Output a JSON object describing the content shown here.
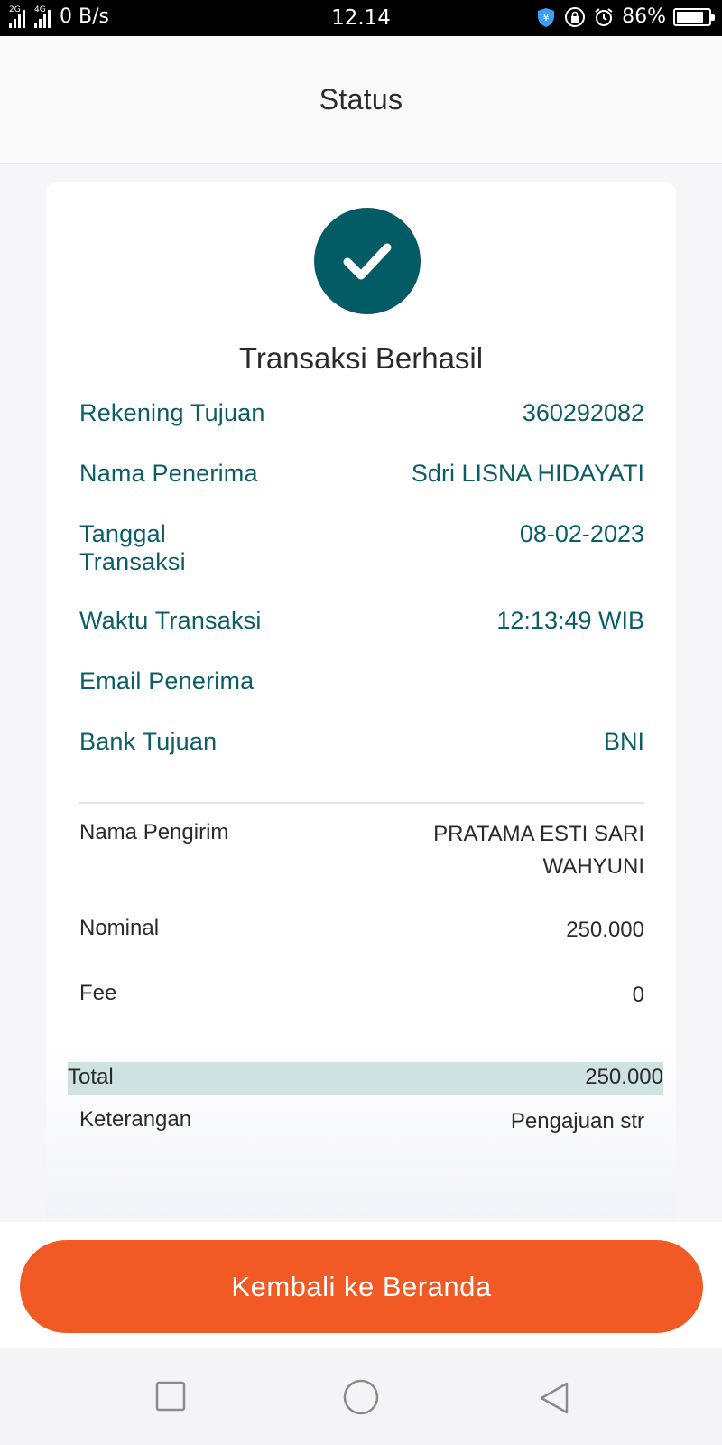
{
  "status_bar": {
    "network_1": "2G",
    "network_2": "4G",
    "speed": "0 B/s",
    "time": "12.14",
    "battery": "86%",
    "battery_level": 0.86
  },
  "header": {
    "title": "Status"
  },
  "result": {
    "title": "Transaksi Berhasil"
  },
  "recipient": [
    {
      "label": "Rekening Tujuan",
      "value": "360292082"
    },
    {
      "label": "Nama Penerima",
      "value": "Sdri LISNA HIDAYATI"
    },
    {
      "label": "Tanggal Transaksi",
      "label_line1": "Tanggal",
      "label_line2": "Transaksi",
      "value": "08-02-2023"
    },
    {
      "label": "Waktu Transaksi",
      "value": "12:13:49 WIB"
    },
    {
      "label": "Email Penerima",
      "value": ""
    },
    {
      "label": "Bank Tujuan",
      "value": "BNI"
    }
  ],
  "details": {
    "sender_label": "Nama Pengirim",
    "sender_line1": "PRATAMA ESTI SARI",
    "sender_line2": "WAHYUNI",
    "nominal_label": "Nominal",
    "nominal_value": "250.000",
    "fee_label": "Fee",
    "fee_value": "0",
    "total_label": "Total",
    "total_value": "250.000",
    "note_label": "Keterangan",
    "note_value": "Pengajuan str"
  },
  "button": {
    "label": "Kembali ke Beranda"
  },
  "colors": {
    "teal": "#035b66",
    "accent_orange": "#f15a24",
    "total_highlight": "#cde2e1"
  }
}
